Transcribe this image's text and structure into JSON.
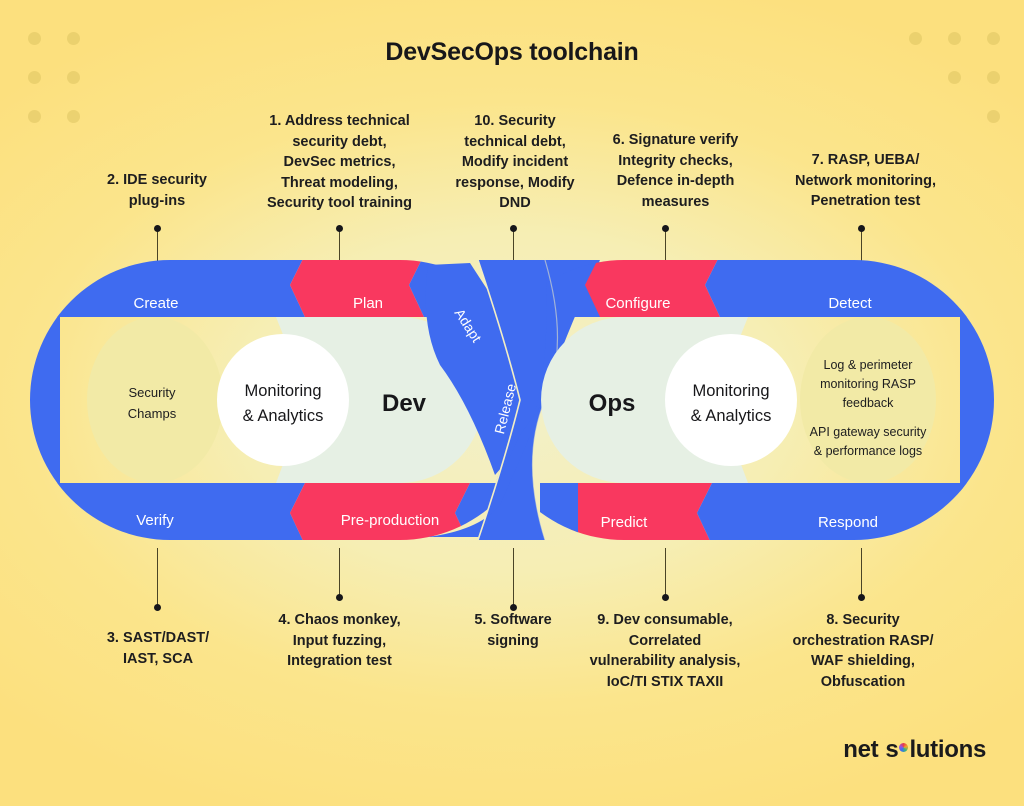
{
  "page": {
    "title": "DevSecOps toolchain",
    "background_color": "#fbe58c",
    "accent_blue": "#3f6bf0",
    "accent_red": "#f9385f",
    "core_fill": "#e6f0e4",
    "inner_fill": "#f2eaa6",
    "white": "#ffffff"
  },
  "logo": {
    "word1": "net",
    "word2_pre": "s",
    "word2_post": "lutions",
    "dot_icon": "rainbow-dot"
  },
  "callouts_top": [
    {
      "id": "callout-2",
      "lines": [
        "2. IDE security",
        "plug-ins"
      ]
    },
    {
      "id": "callout-1",
      "lines": [
        "1. Address technical",
        "security debt,",
        "DevSec metrics,",
        "Threat modeling,",
        "Security tool training"
      ]
    },
    {
      "id": "callout-10",
      "lines": [
        "10. Security",
        "technical debt,",
        "Modify incident",
        "response, Modify",
        "DND"
      ]
    },
    {
      "id": "callout-6",
      "lines": [
        "6. Signature verify",
        "Integrity checks,",
        "Defence in-depth",
        "measures"
      ]
    },
    {
      "id": "callout-7",
      "lines": [
        "7. RASP, UEBA/",
        "Network monitoring,",
        "Penetration test"
      ]
    }
  ],
  "callouts_bottom": [
    {
      "id": "callout-3",
      "lines": [
        "3. SAST/DAST/",
        "IAST, SCA"
      ]
    },
    {
      "id": "callout-4",
      "lines": [
        "4. Chaos monkey,",
        "Input fuzzing,",
        "Integration test"
      ]
    },
    {
      "id": "callout-5",
      "lines": [
        "5. Software",
        "signing"
      ]
    },
    {
      "id": "callout-9",
      "lines": [
        "9. Dev consumable,",
        "Correlated",
        "vulnerability analysis,",
        "IoC/TI STIX TAXII"
      ]
    },
    {
      "id": "callout-8",
      "lines": [
        "8. Security",
        "orchestration RASP/",
        "WAF shielding,",
        "Obfuscation"
      ]
    }
  ],
  "loop": {
    "dev": {
      "core_label": "Dev",
      "monitoring_line1": "Monitoring",
      "monitoring_line2": "& Analytics",
      "inner_note_line1": "Security",
      "inner_note_line2": "Champs",
      "segments": [
        {
          "name": "create",
          "label": "Create",
          "color": "#3f6bf0"
        },
        {
          "name": "plan",
          "label": "Plan",
          "color": "#f9385f"
        },
        {
          "name": "adapt",
          "label": "Adapt",
          "color": "#3f6bf0"
        },
        {
          "name": "verify",
          "label": "Verify",
          "color": "#3f6bf0"
        },
        {
          "name": "pre-production",
          "label": "Pre-production",
          "color": "#f9385f"
        }
      ]
    },
    "center": {
      "release_label": "Release",
      "color": "#3f6bf0"
    },
    "ops": {
      "core_label": "Ops",
      "monitoring_line1": "Monitoring",
      "monitoring_line2": "& Analytics",
      "inner_note_a1": "Log & perimeter",
      "inner_note_a2": "monitoring RASP",
      "inner_note_a3": "feedback",
      "inner_note_b1": "API gateway security",
      "inner_note_b2": "& performance logs",
      "segments": [
        {
          "name": "configure",
          "label": "Configure",
          "color": "#f9385f"
        },
        {
          "name": "detect",
          "label": "Detect",
          "color": "#3f6bf0"
        },
        {
          "name": "predict",
          "label": "Predict",
          "color": "#f9385f"
        },
        {
          "name": "respond",
          "label": "Respond",
          "color": "#3f6bf0"
        }
      ]
    }
  }
}
